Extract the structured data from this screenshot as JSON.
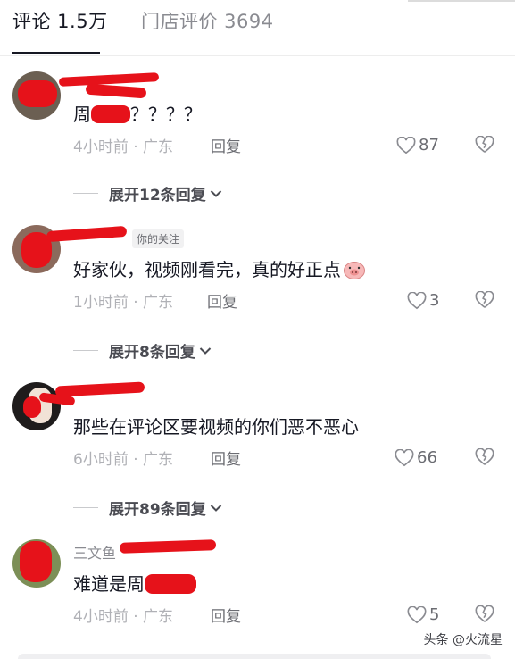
{
  "tabs": {
    "comments_label": "评论 1.5万",
    "store_reviews_label": "门店评价 3694"
  },
  "comments": [
    {
      "text_prefix": "周",
      "text_suffix": "？？？？",
      "time": "4小时前 · 广东",
      "reply_label": "回复",
      "likes": "87",
      "expand_label": "展开12条回复"
    },
    {
      "follow_tag": "你的关注",
      "text": "好家伙，视频刚看完，真的好正点",
      "emoji": "pig-emoji",
      "time": "1小时前 · 广东",
      "reply_label": "回复",
      "likes": "3",
      "expand_label": "展开8条回复"
    },
    {
      "text": "那些在评论区要视频的你们恶不恶心",
      "time": "6小时前 · 广东",
      "reply_label": "回复",
      "likes": "66",
      "expand_label": "展开89条回复"
    },
    {
      "username_visible": "三文鱼",
      "text_prefix": "难道是周",
      "time": "4小时前 · 广东",
      "reply_label": "回复",
      "likes": "5"
    }
  ],
  "watermark": "头条 @火流星",
  "colors": {
    "redaction": "#e6121a",
    "muted": "#8a8b91",
    "text": "#161823"
  }
}
